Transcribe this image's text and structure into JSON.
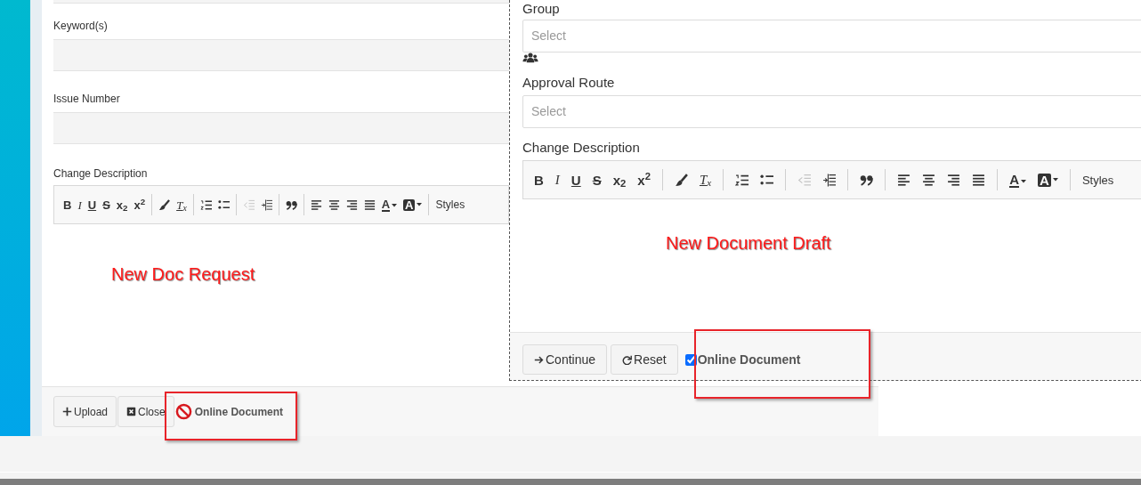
{
  "left_form": {
    "fields": [
      {
        "label": "Keyword(s)"
      },
      {
        "label": "Issue Number"
      }
    ],
    "editor": {
      "label": "Change Description",
      "toolbar": [
        {
          "kind": "bold",
          "label": "B",
          "disabled": false
        },
        {
          "kind": "italic",
          "label": "I",
          "disabled": false
        },
        {
          "kind": "underline",
          "label": "U",
          "disabled": false
        },
        {
          "kind": "strike",
          "label": "S",
          "disabled": false
        },
        {
          "kind": "script",
          "label": "x$_{2}$",
          "disabled": false
        },
        {
          "kind": "script",
          "label": "x$^{2}$",
          "disabled": false
        },
        {
          "kind": "separator"
        },
        {
          "kind": "brush",
          "disabled": false
        },
        {
          "kind": "clear-format",
          "label": "T$_{x}$",
          "disabled": false
        },
        {
          "kind": "separator"
        },
        {
          "kind": "ordered-list",
          "disabled": false
        },
        {
          "kind": "bullet-list",
          "disabled": false
        },
        {
          "kind": "separator"
        },
        {
          "kind": "outdent",
          "disabled": true
        },
        {
          "kind": "indent",
          "disabled": false
        },
        {
          "kind": "separator"
        },
        {
          "kind": "quote",
          "disabled": false
        },
        {
          "kind": "separator"
        },
        {
          "kind": "align-left",
          "disabled": false
        },
        {
          "kind": "align-center",
          "disabled": false
        },
        {
          "kind": "align-right",
          "disabled": false
        },
        {
          "kind": "justify",
          "disabled": false
        },
        {
          "kind": "text-color",
          "label": "A",
          "disabled": false
        },
        {
          "kind": "background-color",
          "label": "A",
          "disabled": false
        },
        {
          "kind": "separator"
        },
        {
          "kind": "styles",
          "label": "Styles",
          "disabled": false
        }
      ]
    },
    "footer": {
      "buttons": [
        {
          "kind": "upload",
          "label": "Upload"
        },
        {
          "kind": "close",
          "label": "Close"
        }
      ],
      "online_document": {
        "kind": "blocked",
        "label": "Online Document"
      }
    }
  },
  "right_form": {
    "group": {
      "label": "Group",
      "placeholder": "Select"
    },
    "approval_route": {
      "label": "Approval Route",
      "placeholder": "Select"
    },
    "editor": {
      "label": "Change Description",
      "toolbar": [
        {
          "kind": "bold",
          "label": "B",
          "disabled": false
        },
        {
          "kind": "italic",
          "label": "I",
          "disabled": false
        },
        {
          "kind": "underline",
          "label": "U",
          "disabled": false
        },
        {
          "kind": "strike",
          "label": "S",
          "disabled": false
        },
        {
          "kind": "script",
          "label": "x$_{2}$",
          "disabled": false
        },
        {
          "kind": "script",
          "label": "x$^{2}$",
          "disabled": false
        },
        {
          "kind": "separator"
        },
        {
          "kind": "brush",
          "disabled": false
        },
        {
          "kind": "clear-format",
          "label": "T$_{x}$",
          "disabled": false
        },
        {
          "kind": "separator"
        },
        {
          "kind": "ordered-list",
          "disabled": false
        },
        {
          "kind": "bullet-list",
          "disabled": false
        },
        {
          "kind": "separator"
        },
        {
          "kind": "outdent",
          "disabled": true
        },
        {
          "kind": "indent",
          "disabled": false
        },
        {
          "kind": "separator"
        },
        {
          "kind": "quote",
          "disabled": false
        },
        {
          "kind": "separator"
        },
        {
          "kind": "align-left",
          "disabled": false
        },
        {
          "kind": "align-center",
          "disabled": false
        },
        {
          "kind": "align-right",
          "disabled": false
        },
        {
          "kind": "justify",
          "disabled": false
        },
        {
          "kind": "separator"
        },
        {
          "kind": "text-color",
          "label": "A",
          "disabled": false
        },
        {
          "kind": "background-color",
          "label": "A",
          "disabled": false
        },
        {
          "kind": "separator"
        },
        {
          "kind": "styles",
          "label": "Styles",
          "disabled": false
        }
      ]
    },
    "footer": {
      "buttons": [
        {
          "kind": "continue",
          "label": "Continue"
        },
        {
          "kind": "reset",
          "label": "Reset"
        }
      ],
      "online_document": {
        "kind": "checkbox",
        "label": "Online Document",
        "checked": true
      }
    }
  },
  "annotations": [
    {
      "text": "New Doc Request"
    },
    {
      "text": "New Document Draft"
    }
  ]
}
